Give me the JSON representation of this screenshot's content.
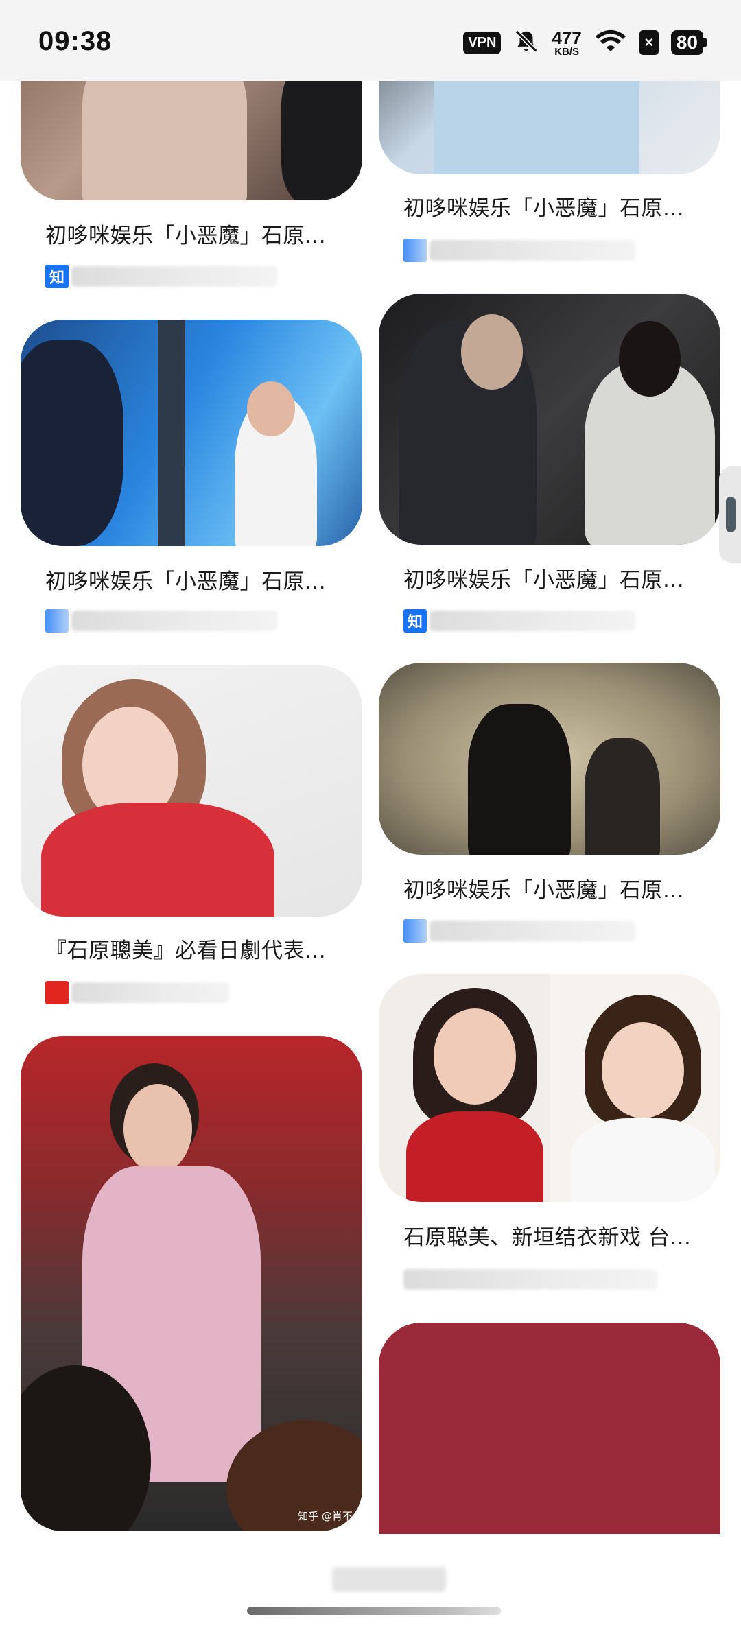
{
  "status_bar": {
    "time": "09:38",
    "vpn": "VPN",
    "net_speed": "477",
    "net_unit": "KB/S",
    "sim_mark": "×",
    "battery": "80"
  },
  "feed": {
    "items": [
      {
        "title": "初哆咪娱乐「小恶魔」石原...",
        "source_icon": "知"
      },
      {
        "title": "初哆咪娱乐「小恶魔」石原...",
        "source_icon": ""
      },
      {
        "title": "初哆咪娱乐「小恶魔」石原...",
        "source_icon": ""
      },
      {
        "title": "初哆咪娱乐「小恶魔」石原...",
        "source_icon": "知"
      },
      {
        "title": "『石原聰美』必看日劇代表...",
        "source_icon": ""
      },
      {
        "title": "初哆咪娱乐「小恶魔」石原...",
        "source_icon": ""
      },
      {
        "title": "石原聪美、新垣结衣新戏 台...",
        "source_icon": ""
      }
    ],
    "watermark": "知乎 @肖不"
  },
  "colors": {
    "zhihu_blue": "#1772f6",
    "maroon_card": "#9a2a3a"
  }
}
